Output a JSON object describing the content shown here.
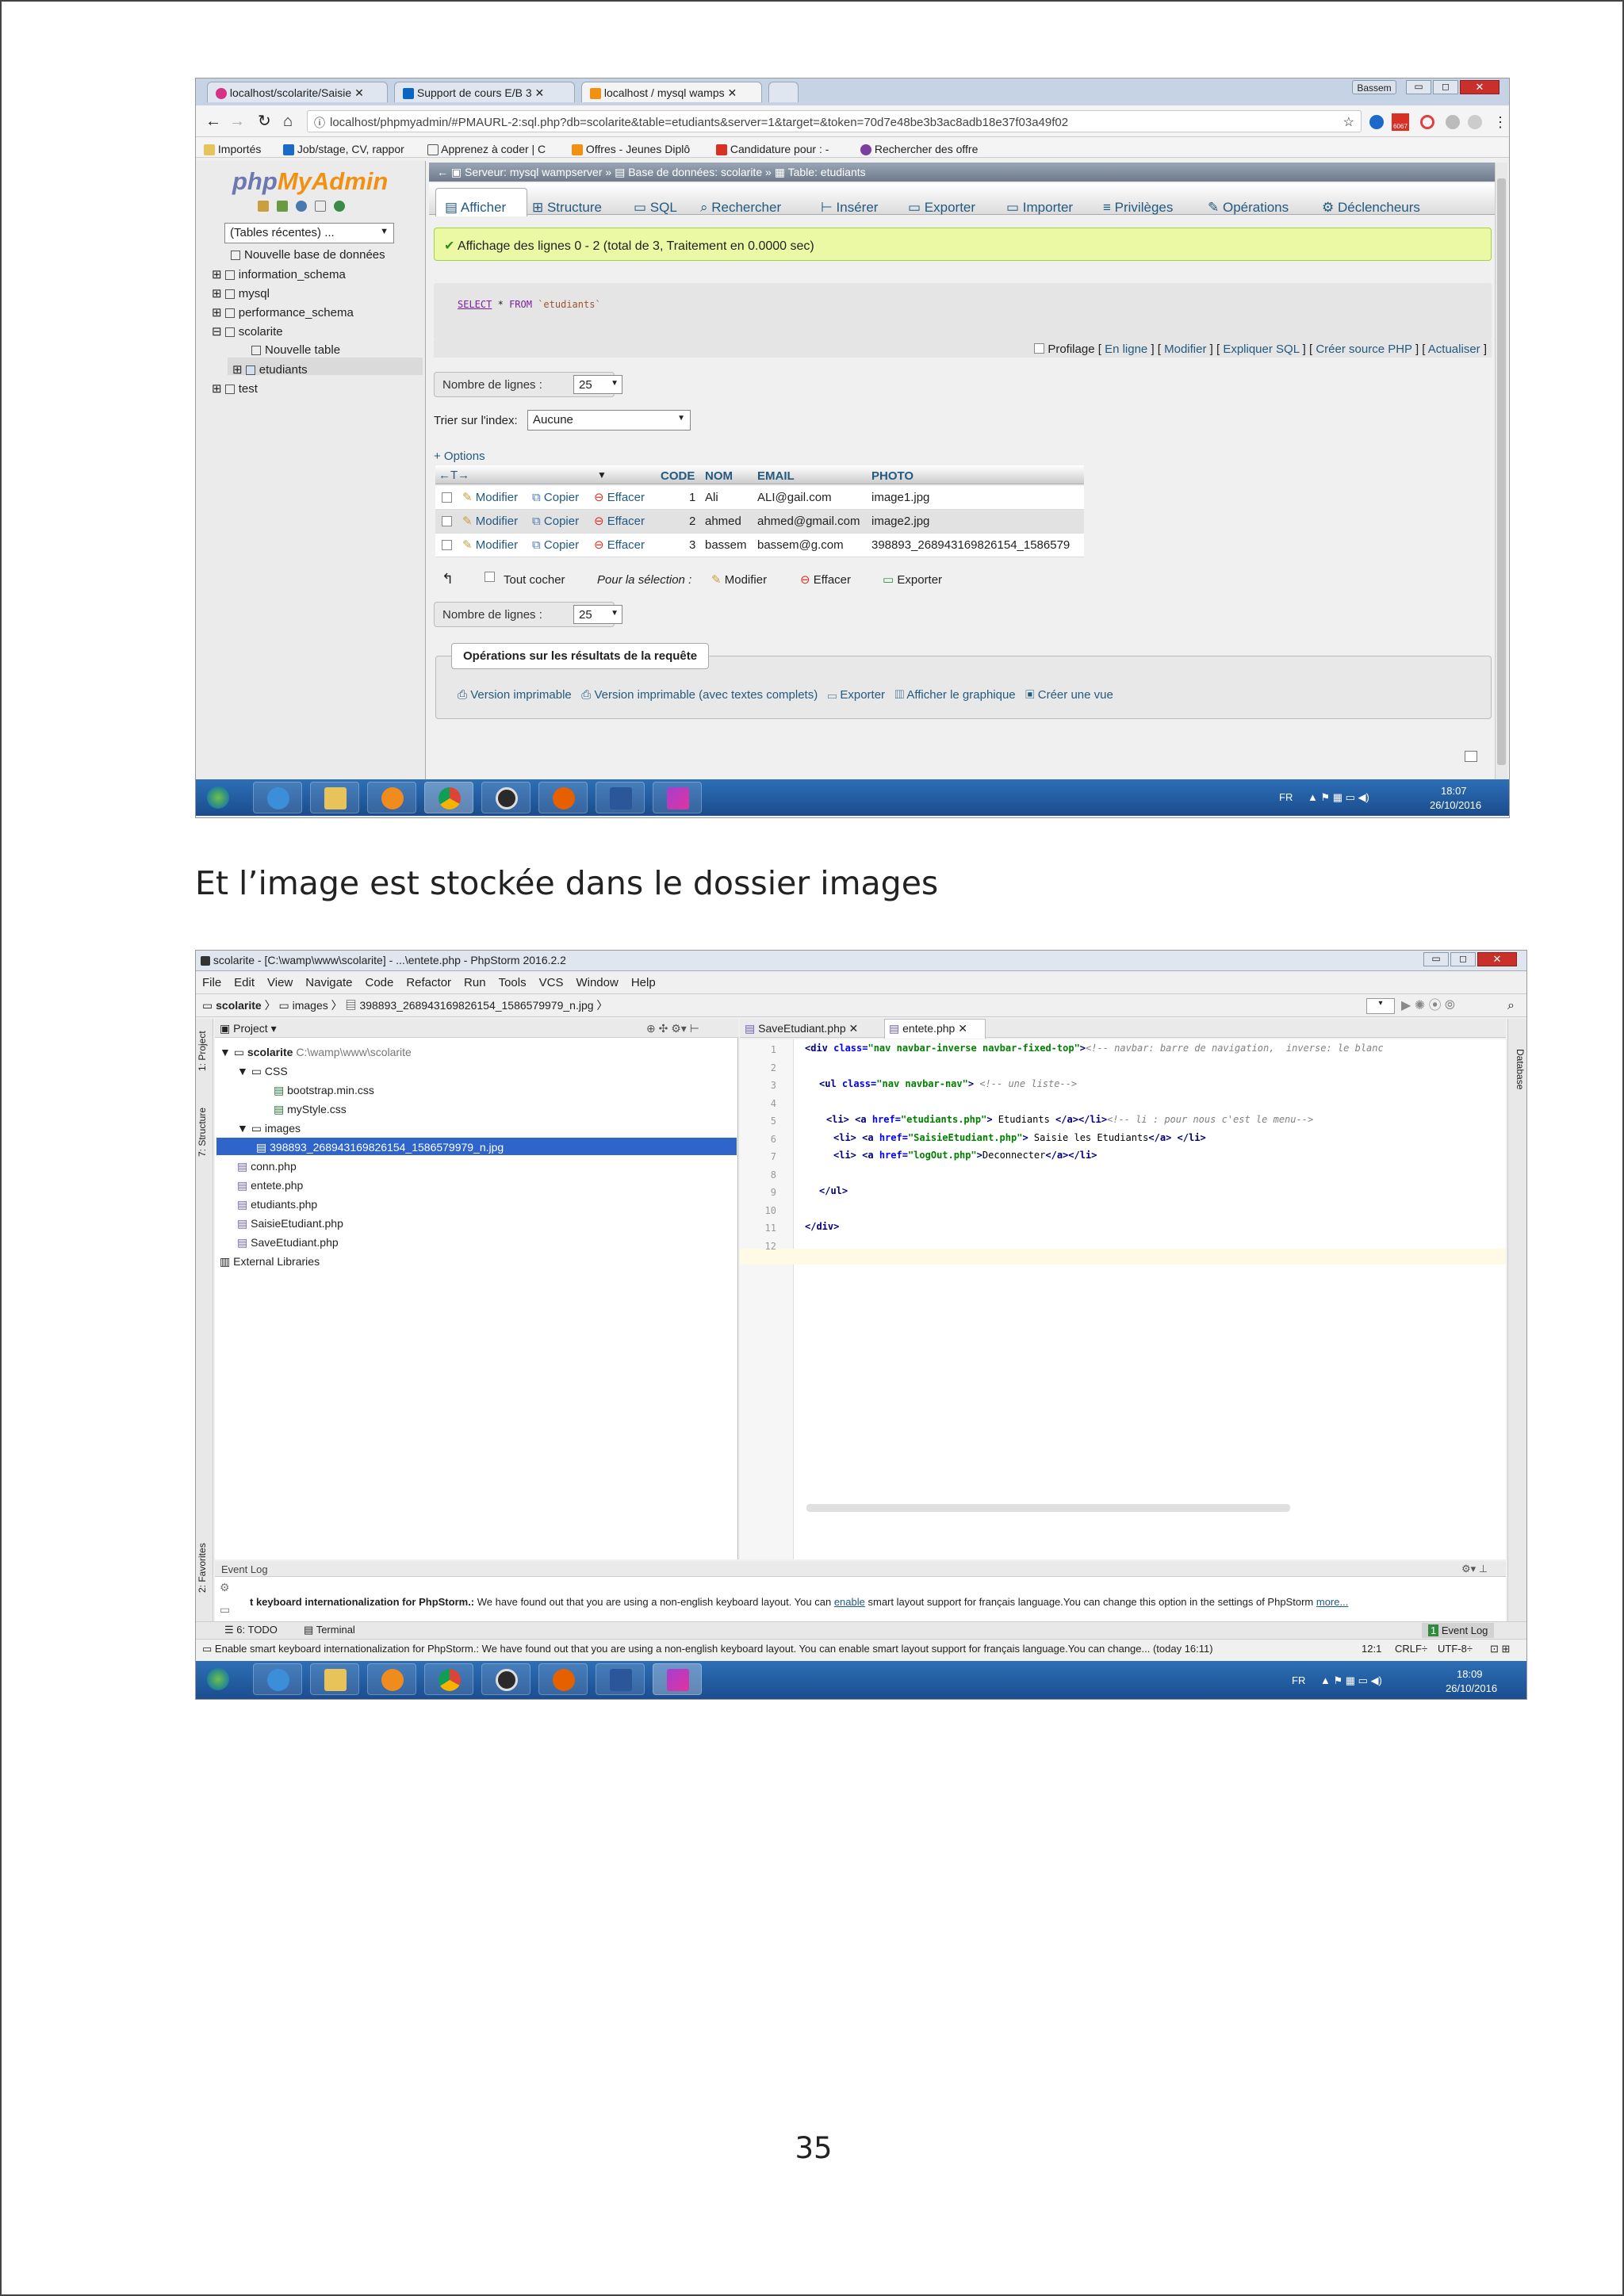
{
  "document": {
    "caption": "Et l’image est stockée dans le dossier images",
    "page_number": "35"
  },
  "shot1": {
    "browser": {
      "tabs": [
        "localhost/scolarite/Saisie",
        "Support de cours E/B 3",
        "localhost / mysql wamps"
      ],
      "user": "Bassem",
      "url": "localhost/phpmyadmin/#PMAURL-2:sql.php?db=scolarite&table=etudiants&server=1&target=&token=70d7e48be3b3ac8adb18e37f03a49f02",
      "mail_count": "6067",
      "bookmarks": [
        "Importés",
        "Job/stage, CV, rappor",
        "Apprenez à coder | C",
        "Offres - Jeunes Diplô",
        "Candidature pour : -",
        "Rechercher des offre"
      ]
    },
    "pma": {
      "logo_php": "php",
      "logo_myadmin": "MyAdmin",
      "recent_tables": "(Tables récentes) ...",
      "tree": [
        "Nouvelle base de données",
        "information_schema",
        "mysql",
        "performance_schema",
        "scolarite",
        "Nouvelle table",
        "etudiants",
        "test"
      ],
      "breadcrumb": [
        "Serveur: mysql wampserver",
        "Base de données: scolarite",
        "Table: etudiants"
      ],
      "tabs": [
        "Afficher",
        "Structure",
        "SQL",
        "Rechercher",
        "Insérer",
        "Exporter",
        "Importer",
        "Privilèges",
        "Opérations",
        "Déclencheurs"
      ],
      "success_message": "Affichage des lignes 0 - 2 (total de 3, Traitement en 0.0000 sec)",
      "sql_keyword_select": "SELECT",
      "sql_star": "*",
      "sql_keyword_from": "FROM",
      "sql_table": "`etudiants`",
      "profiling": [
        "Profilage",
        "En ligne",
        "Modifier",
        "Expliquer SQL",
        "Créer source PHP",
        "Actualiser"
      ],
      "rows_label": "Nombre de lignes :",
      "rows_value": "25",
      "sort_label": "Trier sur l'index:",
      "sort_value": "Aucune",
      "options_label": "+ Options",
      "columns": [
        "CODE",
        "NOM",
        "EMAIL",
        "PHOTO"
      ],
      "row_actions": [
        "Modifier",
        "Copier",
        "Effacer"
      ],
      "rows": [
        {
          "code": "1",
          "nom": "Ali",
          "email": "ALI@gail.com",
          "photo": "image1.jpg"
        },
        {
          "code": "2",
          "nom": "ahmed",
          "email": "ahmed@gmail.com",
          "photo": "image2.jpg"
        },
        {
          "code": "3",
          "nom": "bassem",
          "email": "bassem@g.com",
          "photo": "398893_268943169826154_1586579"
        }
      ],
      "check_all": "Tout cocher",
      "for_selection": "Pour la sélection :",
      "bulk_actions": [
        "Modifier",
        "Effacer",
        "Exporter"
      ],
      "operations_title": "Opérations sur les résultats de la requête",
      "operations": [
        "Version imprimable",
        "Version imprimable (avec textes complets)",
        "Exporter",
        "Afficher le graphique",
        "Créer une vue"
      ]
    },
    "taskbar": {
      "lang": "FR",
      "time": "18:07",
      "date": "26/10/2016"
    }
  },
  "shot2": {
    "window_title": "scolarite - [C:\\wamp\\www\\scolarite] - ...\\entete.php - PhpStorm 2016.2.2",
    "menu": [
      "File",
      "Edit",
      "View",
      "Navigate",
      "Code",
      "Refactor",
      "Run",
      "Tools",
      "VCS",
      "Window",
      "Help"
    ],
    "breadcrumb": [
      "scolarite",
      "images",
      "398893_268943169826154_1586579979_n.jpg"
    ],
    "side_tabs": [
      "1: Project",
      "7: Structure",
      "2: Favorites"
    ],
    "right_tab": "Database",
    "project_panel": {
      "title": "Project",
      "root": "scolarite",
      "root_path": "C:\\wamp\\www\\scolarite",
      "items": [
        "CSS",
        "bootstrap.min.css",
        "myStyle.css",
        "images",
        "398893_268943169826154_1586579979_n.jpg",
        "conn.php",
        "entete.php",
        "etudiants.php",
        "SaisieEtudiant.php",
        "SaveEtudiant.php",
        "External Libraries"
      ]
    },
    "editor_tabs": [
      "SaveEtudiant.php",
      "entete.php"
    ],
    "code": [
      {
        "indent": 0,
        "parts": [
          [
            "tag",
            "<div "
          ],
          [
            "attr",
            "class="
          ],
          [
            "str",
            "\"nav navbar-inverse navbar-fixed-top\""
          ],
          [
            "tag",
            ">"
          ],
          [
            "cmt",
            "<!-- navbar: barre de navigation,  inverse: le blanc"
          ]
        ]
      },
      {
        "indent": 0,
        "parts": []
      },
      {
        "indent": 2,
        "parts": [
          [
            "tag",
            "<ul "
          ],
          [
            "attr",
            "class="
          ],
          [
            "str",
            "\"nav navbar-nav\""
          ],
          [
            "tag",
            ">"
          ],
          [
            "cmt",
            " <!-- une liste-->"
          ]
        ]
      },
      {
        "indent": 0,
        "parts": []
      },
      {
        "indent": 3,
        "parts": [
          [
            "tag",
            "<li>"
          ],
          [
            "plain",
            " "
          ],
          [
            "tag",
            "<a "
          ],
          [
            "attr",
            "href="
          ],
          [
            "str",
            "\"etudiants.php\""
          ],
          [
            "tag",
            ">"
          ],
          [
            "plain",
            " Etudiants "
          ],
          [
            "tag",
            "</a></li>"
          ],
          [
            "cmt",
            "<!-- li : pour nous c'est le menu-->"
          ]
        ]
      },
      {
        "indent": 4,
        "parts": [
          [
            "tag",
            "<li>"
          ],
          [
            "plain",
            " "
          ],
          [
            "tag",
            "<a "
          ],
          [
            "attr",
            "href="
          ],
          [
            "str",
            "\"SaisieEtudiant.php\""
          ],
          [
            "tag",
            ">"
          ],
          [
            "plain",
            " Saisie les Etudiants"
          ],
          [
            "tag",
            "</a>"
          ],
          [
            "plain",
            " "
          ],
          [
            "tag",
            "</li>"
          ]
        ]
      },
      {
        "indent": 4,
        "parts": [
          [
            "tag",
            "<li>"
          ],
          [
            "plain",
            " "
          ],
          [
            "tag",
            "<a "
          ],
          [
            "attr",
            "href="
          ],
          [
            "str",
            "\"logOut.php\""
          ],
          [
            "tag",
            ">"
          ],
          [
            "plain",
            "Deconnecter"
          ],
          [
            "tag",
            "</a></li>"
          ]
        ]
      },
      {
        "indent": 0,
        "parts": []
      },
      {
        "indent": 2,
        "parts": [
          [
            "tag",
            "</ul>"
          ]
        ]
      },
      {
        "indent": 0,
        "parts": []
      },
      {
        "indent": 0,
        "parts": [
          [
            "tag",
            "</div>"
          ]
        ]
      },
      {
        "indent": 0,
        "parts": []
      }
    ],
    "code_colors": {
      "tag": "#000080",
      "attr": "#0000ff",
      "str": "#008000",
      "cmt": "#808080",
      "plain": "#000000"
    },
    "event_log": {
      "title": "Event Log",
      "msg_bold": "t keyboard internationalization for PhpStorm.:",
      "msg_1": "We have found out that you are using a non-english keyboard layout. You can",
      "msg_link": "enable",
      "msg_2": "smart layout support for français language.You can change this option in the settings of PhpStorm",
      "more": "more..."
    },
    "bottom_tools": [
      "6: TODO",
      "Terminal",
      "1",
      "Event Log"
    ],
    "status": {
      "message": "Enable smart keyboard internationalization for PhpStorm.: We have found out that you are using a non-english keyboard layout. You can enable smart layout support for français language.You can change... (today 16:11)",
      "position": "12:1",
      "line_sep": "CRLF÷",
      "encoding": "UTF-8÷"
    },
    "taskbar": {
      "lang": "FR",
      "time": "18:09",
      "date": "26/10/2016"
    }
  }
}
